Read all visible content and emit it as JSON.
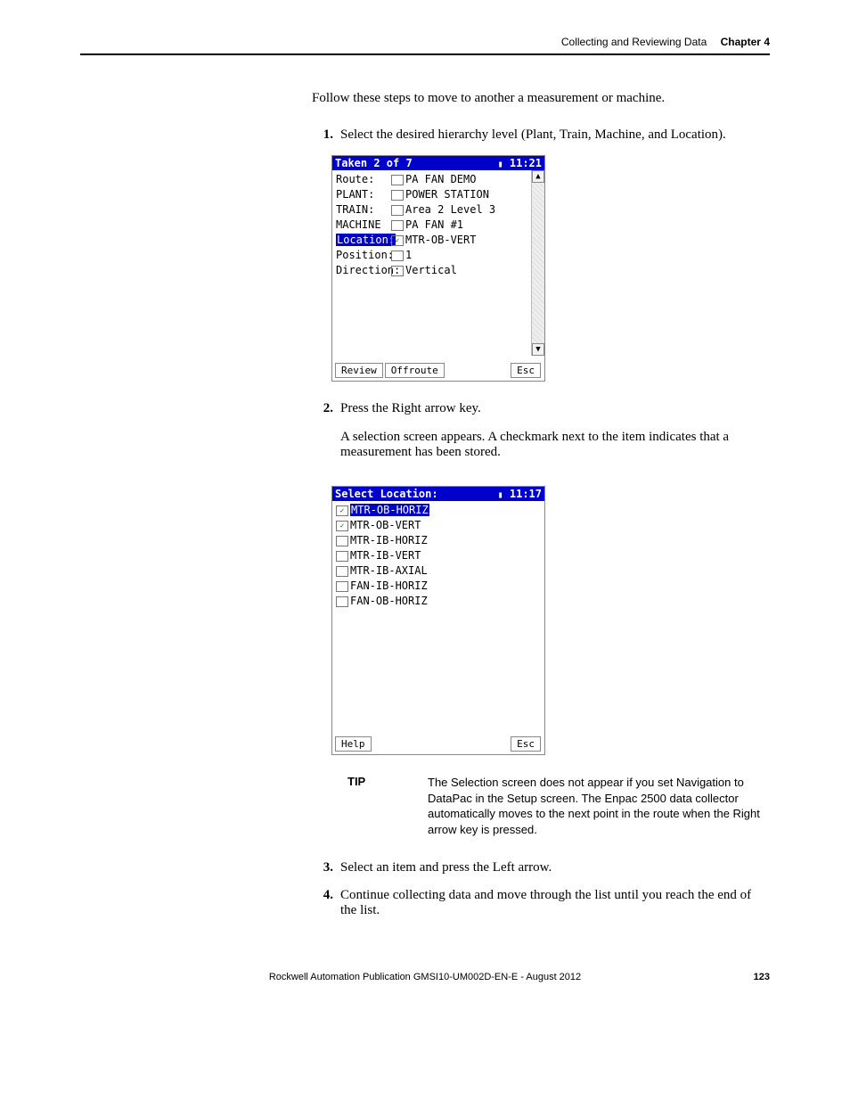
{
  "header": {
    "section": "Collecting and Reviewing Data",
    "chapter": "Chapter 4"
  },
  "intro": "Follow these steps to move to another a measurement or machine.",
  "steps": {
    "s1": {
      "num": "1.",
      "text": "Select the desired hierarchy level (Plant, Train, Machine, and Location)."
    },
    "s2": {
      "num": "2.",
      "text": "Press the Right arrow key.",
      "text2": "A selection screen appears. A checkmark next to the item indicates that a measurement has been stored."
    },
    "s3": {
      "num": "3.",
      "text": "Select an item and press the Left arrow."
    },
    "s4": {
      "num": "4.",
      "text": "Continue collecting data and move through the list until you reach the end of the list."
    }
  },
  "device1": {
    "title": "Taken 2 of 7",
    "time": "11:21",
    "rows": {
      "route": {
        "label": "Route:",
        "value": "PA FAN DEMO"
      },
      "plant": {
        "label": "PLANT:",
        "value": "POWER STATION"
      },
      "train": {
        "label": "TRAIN:",
        "value": "Area 2 Level 3"
      },
      "machine": {
        "label": "MACHINE",
        "value": "PA FAN #1"
      },
      "location": {
        "label": "Location:",
        "value": "MTR-OB-VERT"
      },
      "position": {
        "label": "Position:",
        "value": "1"
      },
      "direction": {
        "label": "Direction:",
        "value": "Vertical"
      }
    },
    "buttons": {
      "review": "Review",
      "offroute": "Offroute",
      "esc": "Esc"
    }
  },
  "device2": {
    "title": "Select Location:",
    "time": "11:17",
    "items": [
      {
        "name": "MTR-OB-HORIZ",
        "checked": true,
        "selected": true
      },
      {
        "name": "MTR-OB-VERT",
        "checked": true,
        "selected": false
      },
      {
        "name": "MTR-IB-HORIZ",
        "checked": false,
        "selected": false
      },
      {
        "name": "MTR-IB-VERT",
        "checked": false,
        "selected": false
      },
      {
        "name": "MTR-IB-AXIAL",
        "checked": false,
        "selected": false
      },
      {
        "name": "FAN-IB-HORIZ",
        "checked": false,
        "selected": false
      },
      {
        "name": "FAN-OB-HORIZ",
        "checked": false,
        "selected": false
      }
    ],
    "buttons": {
      "help": "Help",
      "esc": "Esc"
    }
  },
  "tip": {
    "label": "TIP",
    "text": "The Selection screen does not appear if you set Navigation to DataPac in the Setup screen. The Enpac 2500 data collector automatically moves to the next point in the route when the Right arrow key is pressed."
  },
  "footer": {
    "pub": "Rockwell Automation Publication GMSI10-UM002D-EN-E - August 2012",
    "page": "123"
  }
}
